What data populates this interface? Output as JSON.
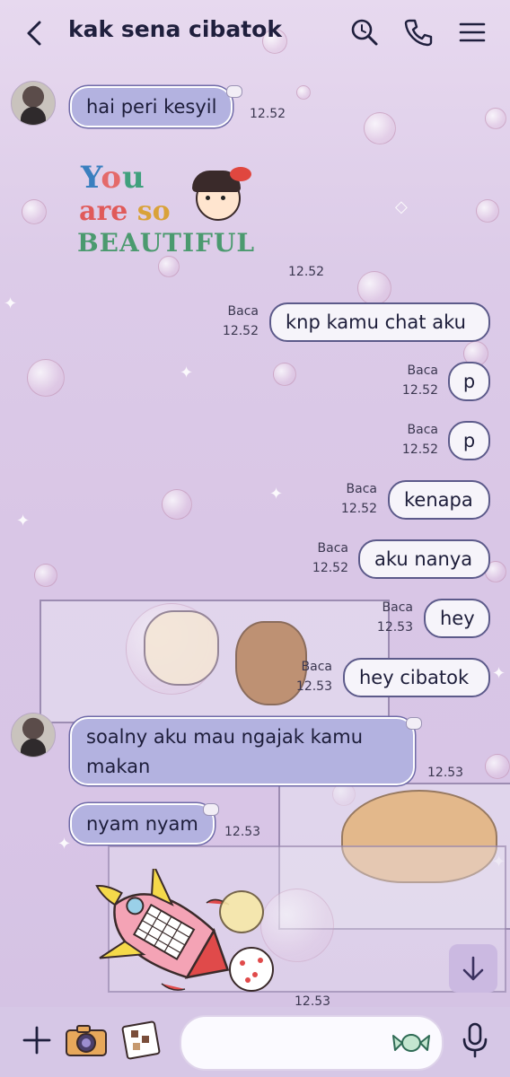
{
  "header": {
    "title": "kak sena cibatok",
    "back_icon": "chevron-left-icon",
    "search_icon": "search-icon",
    "call_icon": "phone-icon",
    "menu_icon": "menu-icon"
  },
  "messages": [
    {
      "dir": "in",
      "text": "hai peri kesyil",
      "time": "12.52"
    },
    {
      "dir": "in",
      "sticker_text": "You are so BEAUTIFUL",
      "time": "12.52"
    },
    {
      "dir": "out",
      "text": "knp kamu chat aku",
      "status": "Baca",
      "time": "12.52"
    },
    {
      "dir": "out",
      "text": "p",
      "status": "Baca",
      "time": "12.52"
    },
    {
      "dir": "out",
      "text": "p",
      "status": "Baca",
      "time": "12.52"
    },
    {
      "dir": "out",
      "text": "kenapa",
      "status": "Baca",
      "time": "12.52"
    },
    {
      "dir": "out",
      "text": "aku nanya",
      "status": "Baca",
      "time": "12.52"
    },
    {
      "dir": "out",
      "text": "hey",
      "status": "Baca",
      "time": "12.53"
    },
    {
      "dir": "out",
      "text": "hey cibatok",
      "status": "Baca",
      "time": "12.53"
    },
    {
      "dir": "in",
      "text": "soalny aku mau ngajak kamu makan",
      "time": "12.53"
    },
    {
      "dir": "in",
      "text": "nyam nyam",
      "time": "12.53"
    },
    {
      "dir": "in",
      "sticker": "rocket-sticker",
      "time": "12.53"
    }
  ],
  "input": {
    "placeholder": ""
  },
  "colors": {
    "incoming_bubble": "#b3b2e0",
    "outgoing_bubble": "#f6f4fa",
    "background": "#dccbe8",
    "title": "#1f1f3d"
  }
}
